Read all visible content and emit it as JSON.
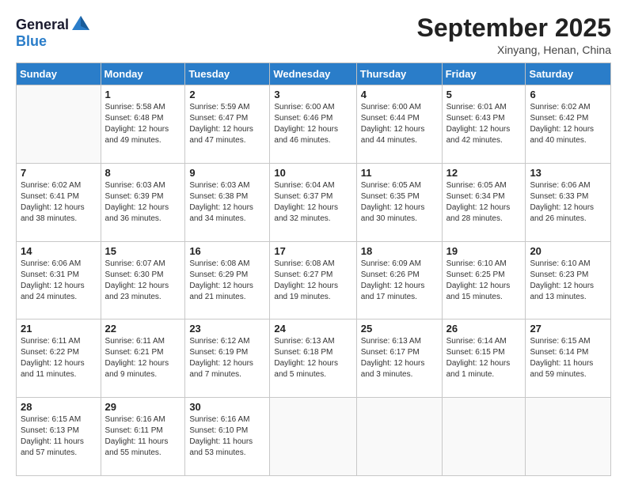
{
  "header": {
    "logo_line1": "General",
    "logo_line2": "Blue",
    "month_title": "September 2025",
    "subtitle": "Xinyang, Henan, China"
  },
  "weekdays": [
    "Sunday",
    "Monday",
    "Tuesday",
    "Wednesday",
    "Thursday",
    "Friday",
    "Saturday"
  ],
  "weeks": [
    [
      {
        "day": "",
        "info": ""
      },
      {
        "day": "1",
        "info": "Sunrise: 5:58 AM\nSunset: 6:48 PM\nDaylight: 12 hours\nand 49 minutes."
      },
      {
        "day": "2",
        "info": "Sunrise: 5:59 AM\nSunset: 6:47 PM\nDaylight: 12 hours\nand 47 minutes."
      },
      {
        "day": "3",
        "info": "Sunrise: 6:00 AM\nSunset: 6:46 PM\nDaylight: 12 hours\nand 46 minutes."
      },
      {
        "day": "4",
        "info": "Sunrise: 6:00 AM\nSunset: 6:44 PM\nDaylight: 12 hours\nand 44 minutes."
      },
      {
        "day": "5",
        "info": "Sunrise: 6:01 AM\nSunset: 6:43 PM\nDaylight: 12 hours\nand 42 minutes."
      },
      {
        "day": "6",
        "info": "Sunrise: 6:02 AM\nSunset: 6:42 PM\nDaylight: 12 hours\nand 40 minutes."
      }
    ],
    [
      {
        "day": "7",
        "info": "Sunrise: 6:02 AM\nSunset: 6:41 PM\nDaylight: 12 hours\nand 38 minutes."
      },
      {
        "day": "8",
        "info": "Sunrise: 6:03 AM\nSunset: 6:39 PM\nDaylight: 12 hours\nand 36 minutes."
      },
      {
        "day": "9",
        "info": "Sunrise: 6:03 AM\nSunset: 6:38 PM\nDaylight: 12 hours\nand 34 minutes."
      },
      {
        "day": "10",
        "info": "Sunrise: 6:04 AM\nSunset: 6:37 PM\nDaylight: 12 hours\nand 32 minutes."
      },
      {
        "day": "11",
        "info": "Sunrise: 6:05 AM\nSunset: 6:35 PM\nDaylight: 12 hours\nand 30 minutes."
      },
      {
        "day": "12",
        "info": "Sunrise: 6:05 AM\nSunset: 6:34 PM\nDaylight: 12 hours\nand 28 minutes."
      },
      {
        "day": "13",
        "info": "Sunrise: 6:06 AM\nSunset: 6:33 PM\nDaylight: 12 hours\nand 26 minutes."
      }
    ],
    [
      {
        "day": "14",
        "info": "Sunrise: 6:06 AM\nSunset: 6:31 PM\nDaylight: 12 hours\nand 24 minutes."
      },
      {
        "day": "15",
        "info": "Sunrise: 6:07 AM\nSunset: 6:30 PM\nDaylight: 12 hours\nand 23 minutes."
      },
      {
        "day": "16",
        "info": "Sunrise: 6:08 AM\nSunset: 6:29 PM\nDaylight: 12 hours\nand 21 minutes."
      },
      {
        "day": "17",
        "info": "Sunrise: 6:08 AM\nSunset: 6:27 PM\nDaylight: 12 hours\nand 19 minutes."
      },
      {
        "day": "18",
        "info": "Sunrise: 6:09 AM\nSunset: 6:26 PM\nDaylight: 12 hours\nand 17 minutes."
      },
      {
        "day": "19",
        "info": "Sunrise: 6:10 AM\nSunset: 6:25 PM\nDaylight: 12 hours\nand 15 minutes."
      },
      {
        "day": "20",
        "info": "Sunrise: 6:10 AM\nSunset: 6:23 PM\nDaylight: 12 hours\nand 13 minutes."
      }
    ],
    [
      {
        "day": "21",
        "info": "Sunrise: 6:11 AM\nSunset: 6:22 PM\nDaylight: 12 hours\nand 11 minutes."
      },
      {
        "day": "22",
        "info": "Sunrise: 6:11 AM\nSunset: 6:21 PM\nDaylight: 12 hours\nand 9 minutes."
      },
      {
        "day": "23",
        "info": "Sunrise: 6:12 AM\nSunset: 6:19 PM\nDaylight: 12 hours\nand 7 minutes."
      },
      {
        "day": "24",
        "info": "Sunrise: 6:13 AM\nSunset: 6:18 PM\nDaylight: 12 hours\nand 5 minutes."
      },
      {
        "day": "25",
        "info": "Sunrise: 6:13 AM\nSunset: 6:17 PM\nDaylight: 12 hours\nand 3 minutes."
      },
      {
        "day": "26",
        "info": "Sunrise: 6:14 AM\nSunset: 6:15 PM\nDaylight: 12 hours\nand 1 minute."
      },
      {
        "day": "27",
        "info": "Sunrise: 6:15 AM\nSunset: 6:14 PM\nDaylight: 11 hours\nand 59 minutes."
      }
    ],
    [
      {
        "day": "28",
        "info": "Sunrise: 6:15 AM\nSunset: 6:13 PM\nDaylight: 11 hours\nand 57 minutes."
      },
      {
        "day": "29",
        "info": "Sunrise: 6:16 AM\nSunset: 6:11 PM\nDaylight: 11 hours\nand 55 minutes."
      },
      {
        "day": "30",
        "info": "Sunrise: 6:16 AM\nSunset: 6:10 PM\nDaylight: 11 hours\nand 53 minutes."
      },
      {
        "day": "",
        "info": ""
      },
      {
        "day": "",
        "info": ""
      },
      {
        "day": "",
        "info": ""
      },
      {
        "day": "",
        "info": ""
      }
    ]
  ]
}
